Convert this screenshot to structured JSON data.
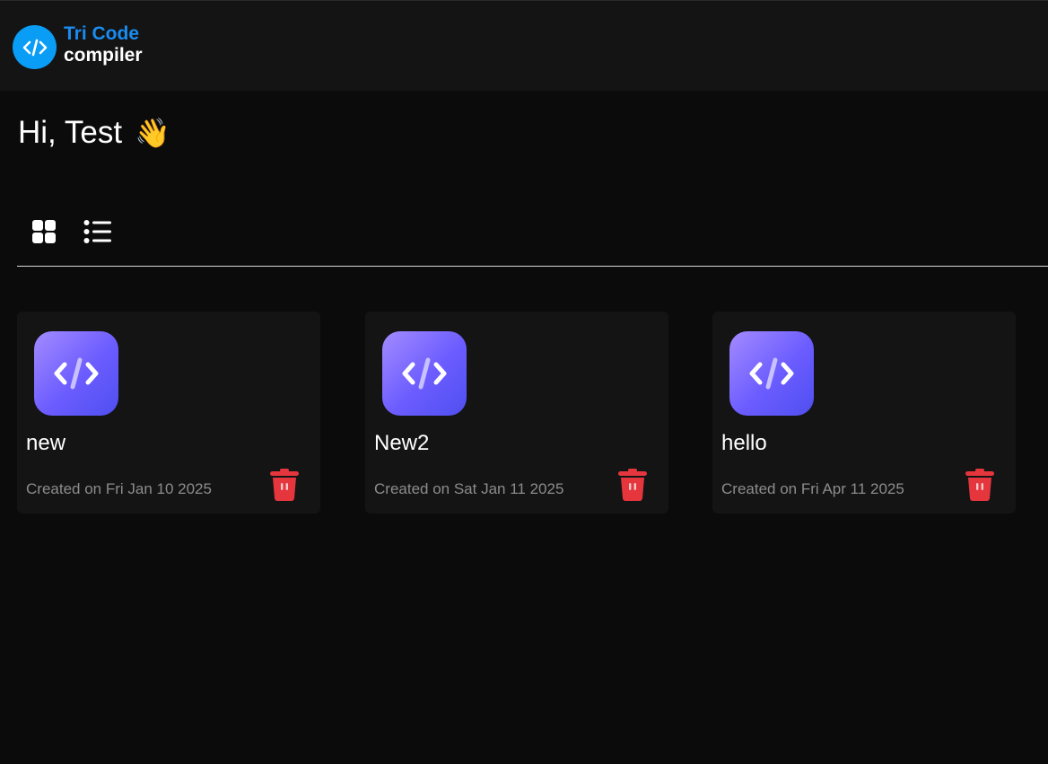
{
  "brand": {
    "name_line1": "Tri Code",
    "name_line2": "compiler",
    "logo_icon": "code-brackets-icon",
    "accent": "#0a9df5"
  },
  "greeting": {
    "text": "Hi, Test",
    "emoji": "👋"
  },
  "view_toggle": {
    "options": [
      "grid-view-icon",
      "list-view-icon"
    ],
    "selected": "grid"
  },
  "projects": [
    {
      "name": "new",
      "created": "Created on Fri Jan 10 2025"
    },
    {
      "name": "New2",
      "created": "Created on Sat Jan 11 2025"
    },
    {
      "name": "hello",
      "created": "Created on Fri Apr 11 2025"
    }
  ],
  "colors": {
    "background": "#0b0b0b",
    "surface": "#141414",
    "delete": "#e5363d",
    "card_icon_gradient": [
      "#a38bff",
      "#4f4ff0"
    ]
  }
}
